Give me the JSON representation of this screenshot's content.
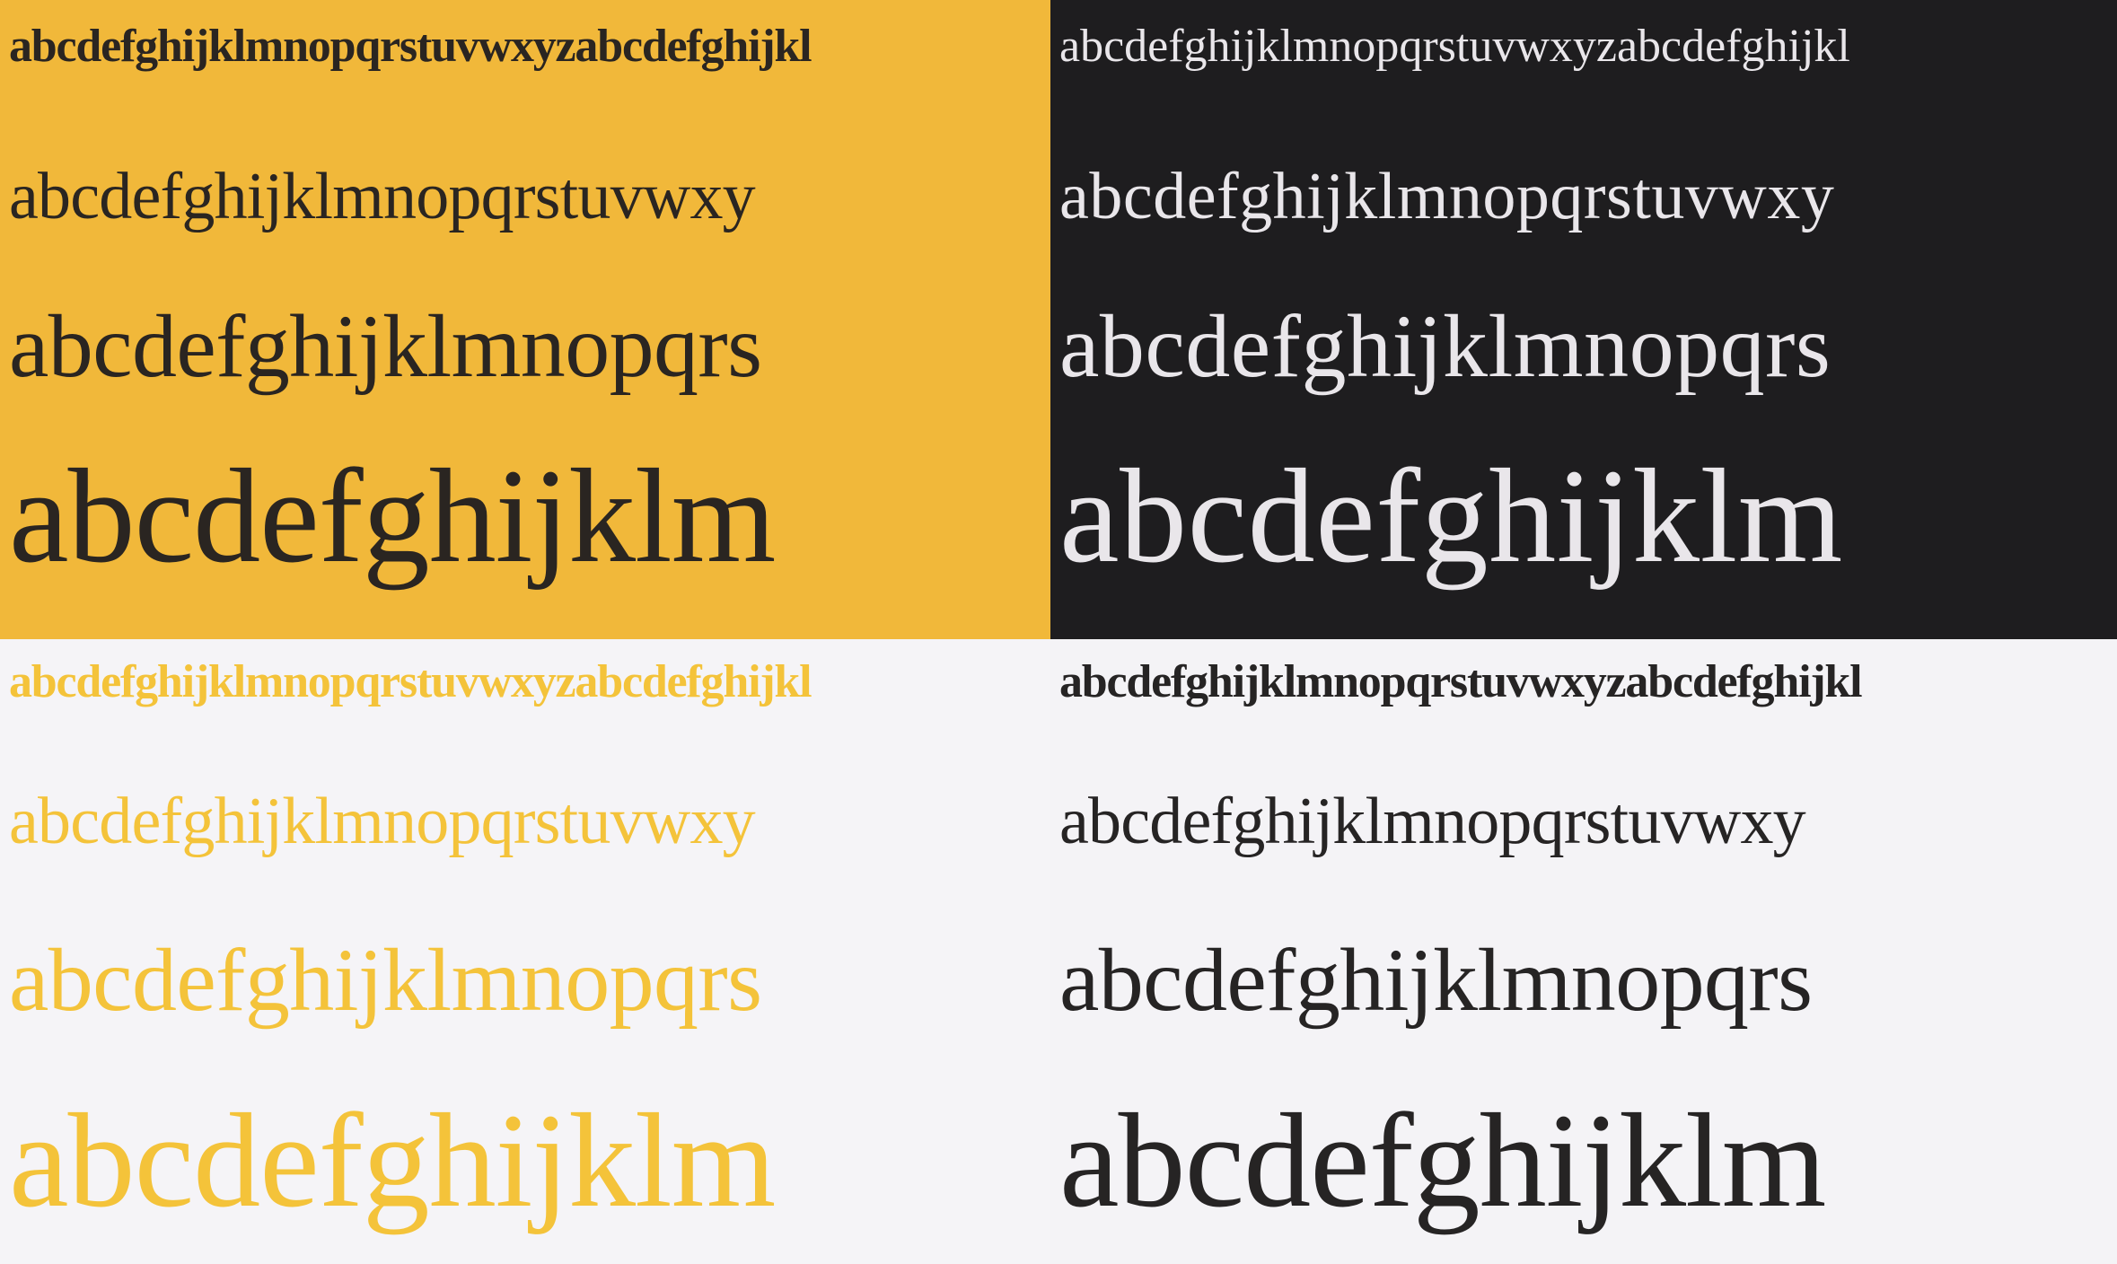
{
  "panels": {
    "yellow_bg": {
      "background_color": "#f1b83a",
      "text_color": "#2a2521",
      "lines": [
        "abcdefghijklmnopqrstuvwxyzabcdefghijkl",
        "abcdefghijklmnopqrstuvwxy",
        "abcdefghijklmnopqrs",
        "abcdefghijklm"
      ]
    },
    "black_bg": {
      "background_color": "#1e1d1f",
      "text_color": "#e9e6ea",
      "lines": [
        "abcdefghijklmnopqrstuvwxyzabcdefghijkl",
        "abcdefghijklmnopqrstuvwxy",
        "abcdefghijklmnopqrs",
        "abcdefghijklm"
      ]
    },
    "yellow_text": {
      "background_color": "#f5f4f7",
      "text_color": "#f4c33a",
      "lines": [
        "abcdefghijklmnopqrstuvwxyzabcdefghijkl",
        "abcdefghijklmnopqrstuvwxy",
        "abcdefghijklmnopqrs",
        "abcdefghijklm"
      ]
    },
    "black_text": {
      "background_color": "#f4f3f6",
      "text_color": "#262424",
      "lines": [
        "abcdefghijklmnopqrstuvwxyzabcdefghijkl",
        "abcdefghijklmnopqrstuvwxy",
        "abcdefghijklmnopqrs",
        "abcdefghijklm"
      ]
    }
  }
}
